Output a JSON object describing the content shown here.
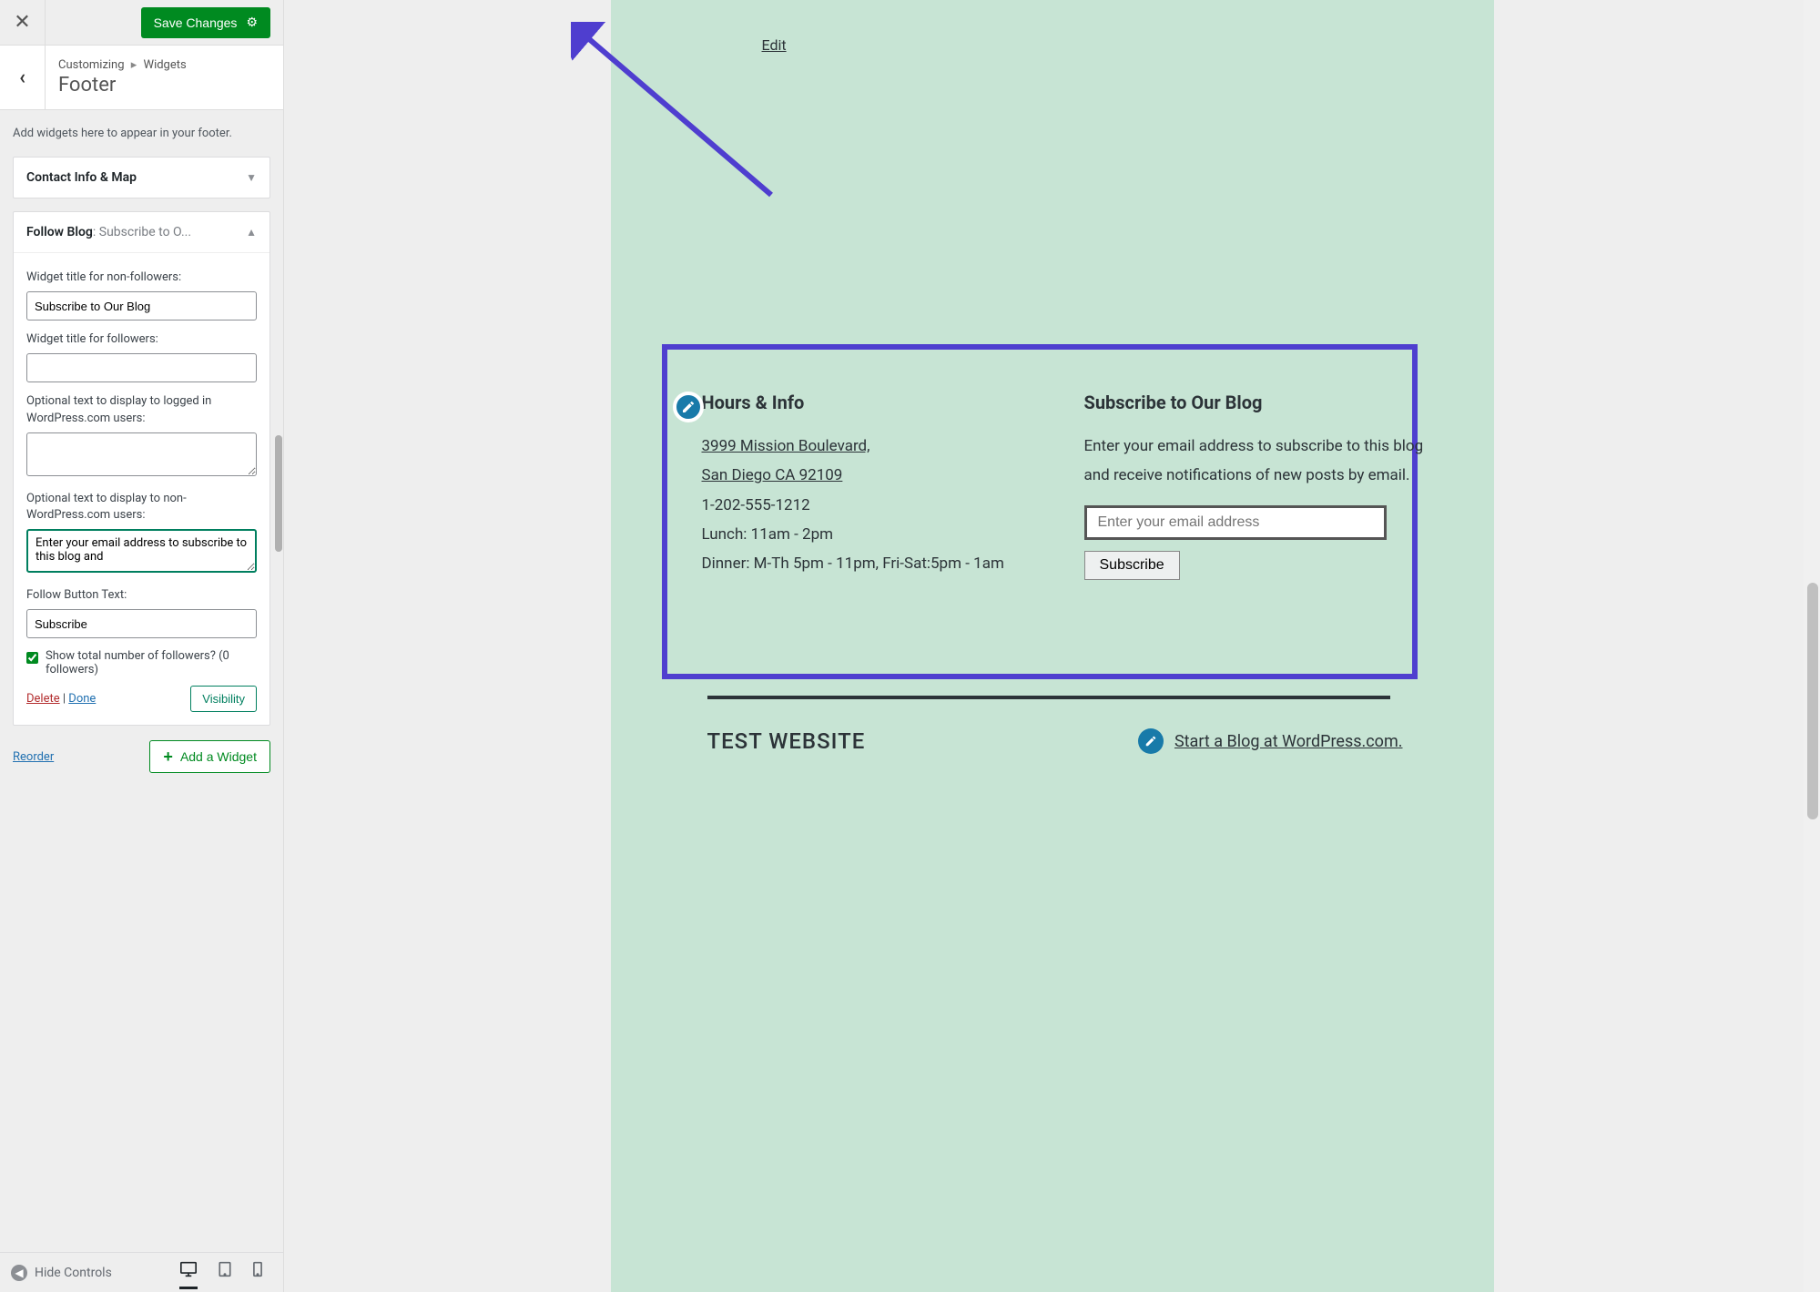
{
  "top": {
    "save_label": "Save Changes",
    "crumb_root": "Customizing",
    "crumb_leaf": "Widgets",
    "section_title": "Footer",
    "description": "Add widgets here to appear in your footer."
  },
  "widgets": {
    "collapsed": {
      "title": "Contact Info & Map"
    },
    "expanded": {
      "title_prefix": "Follow Blog",
      "title_suffix": ": Subscribe to O...",
      "fields": {
        "nonfollow_label": "Widget title for non-followers:",
        "nonfollow_value": "Subscribe to Our Blog",
        "follow_label": "Widget title for followers:",
        "follow_value": "",
        "logged_label": "Optional text to display to logged in WordPress.com users:",
        "logged_value": "",
        "nonlogged_label": "Optional text to display to non-WordPress.com users:",
        "nonlogged_value": "Enter your email address to subscribe to this blog and",
        "button_label": "Follow Button Text:",
        "button_value": "Subscribe",
        "show_followers_label": "Show total number of followers? (0 followers)"
      },
      "actions": {
        "delete": "Delete",
        "done": "Done",
        "visibility": "Visibility"
      }
    }
  },
  "footer_actions": {
    "reorder": "Reorder",
    "add_widget": "Add a Widget"
  },
  "bottombar": {
    "hide_controls": "Hide Controls"
  },
  "preview": {
    "edit_link": "Edit",
    "hours": {
      "heading": "Hours & Info",
      "addr1": "3999 Mission Boulevard,",
      "addr2": "San Diego CA 92109",
      "phone": "1-202-555-1212",
      "lunch": "Lunch: 11am - 2pm",
      "dinner": "Dinner: M-Th 5pm - 11pm, Fri-Sat:5pm - 1am"
    },
    "subscribe": {
      "heading": "Subscribe to Our Blog",
      "desc": "Enter your email address to subscribe to this blog and receive notifications of new posts by email.",
      "placeholder": "Enter your email address",
      "button": "Subscribe"
    },
    "site_name": "TEST WEBSITE",
    "blog_link": "Start a Blog at WordPress.com"
  },
  "colors": {
    "accent_arrow": "#4f3ecf",
    "save_green": "#008a20"
  }
}
